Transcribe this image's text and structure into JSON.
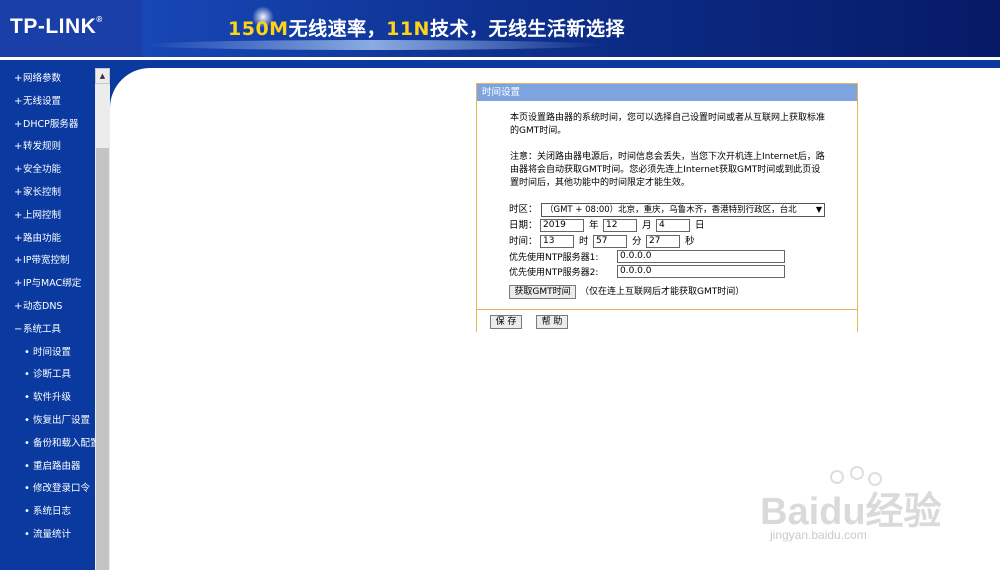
{
  "header": {
    "logo": "TP-LINK",
    "logo_reg": "®",
    "slogan_p1": "150M",
    "slogan_p2": "无线速率，",
    "slogan_p3": "11N",
    "slogan_p4": "技术，无线生活新选择"
  },
  "sidebar": {
    "items": [
      {
        "label": "网络参数",
        "bullet": "+"
      },
      {
        "label": "无线设置",
        "bullet": "+"
      },
      {
        "label": "DHCP服务器",
        "bullet": "+"
      },
      {
        "label": "转发规则",
        "bullet": "+"
      },
      {
        "label": "安全功能",
        "bullet": "+"
      },
      {
        "label": "家长控制",
        "bullet": "+"
      },
      {
        "label": "上网控制",
        "bullet": "+"
      },
      {
        "label": "路由功能",
        "bullet": "+"
      },
      {
        "label": "IP带宽控制",
        "bullet": "+"
      },
      {
        "label": "IP与MAC绑定",
        "bullet": "+"
      },
      {
        "label": "动态DNS",
        "bullet": "+"
      },
      {
        "label": "系统工具",
        "bullet": "−"
      },
      {
        "label": "时间设置",
        "bullet": "•"
      },
      {
        "label": "诊断工具",
        "bullet": "•"
      },
      {
        "label": "软件升级",
        "bullet": "•"
      },
      {
        "label": "恢复出厂设置",
        "bullet": "•"
      },
      {
        "label": "备份和载入配置",
        "bullet": "•"
      },
      {
        "label": "重启路由器",
        "bullet": "•"
      },
      {
        "label": "修改登录口令",
        "bullet": "•"
      },
      {
        "label": "系统日志",
        "bullet": "•"
      },
      {
        "label": "流量统计",
        "bullet": "•"
      }
    ],
    "scroll_up_glyph": "▲"
  },
  "panel": {
    "title": "时间设置",
    "desc1": "本页设置路由器的系统时间，您可以选择自己设置时间或者从互联网上获取标准的GMT时间。",
    "desc2": "注意：关闭路由器电源后，时间信息会丢失，当您下次开机连上Internet后，路由器将会自动获取GMT时间。您必须先连上Internet获取GMT时间或到此页设置时间后，其他功能中的时间限定才能生效。",
    "timezone_label": "时区：",
    "timezone_value": "（GMT + 08:00）北京，重庆，乌鲁木齐，香港特别行政区，台北",
    "date_label": "日期：",
    "year": "2019",
    "year_unit": "年",
    "month": "12",
    "month_unit": "月",
    "day": "4",
    "day_unit": "日",
    "time_label": "时间：",
    "hour": "13",
    "hour_unit": "时",
    "minute": "57",
    "minute_unit": "分",
    "second": "27",
    "second_unit": "秒",
    "ntp1_label": "优先使用NTP服务器1:",
    "ntp1_value": "0.0.0.0",
    "ntp2_label": "优先使用NTP服务器2:",
    "ntp2_value": "0.0.0.0",
    "gmt_button": "获取GMT时间",
    "gmt_note": "（仅在连上互联网后才能获取GMT时间）",
    "save_button": "保 存",
    "help_button": "帮 助"
  },
  "watermark": {
    "brand_text": "Baidu经验",
    "url": "jingyan.baidu.com"
  },
  "colors": {
    "sidebar_bg": "#0a3aa0",
    "panel_title_bg": "#7ea4df",
    "panel_border": "#e8b35a",
    "slogan_highlight": "#ffd21a"
  }
}
